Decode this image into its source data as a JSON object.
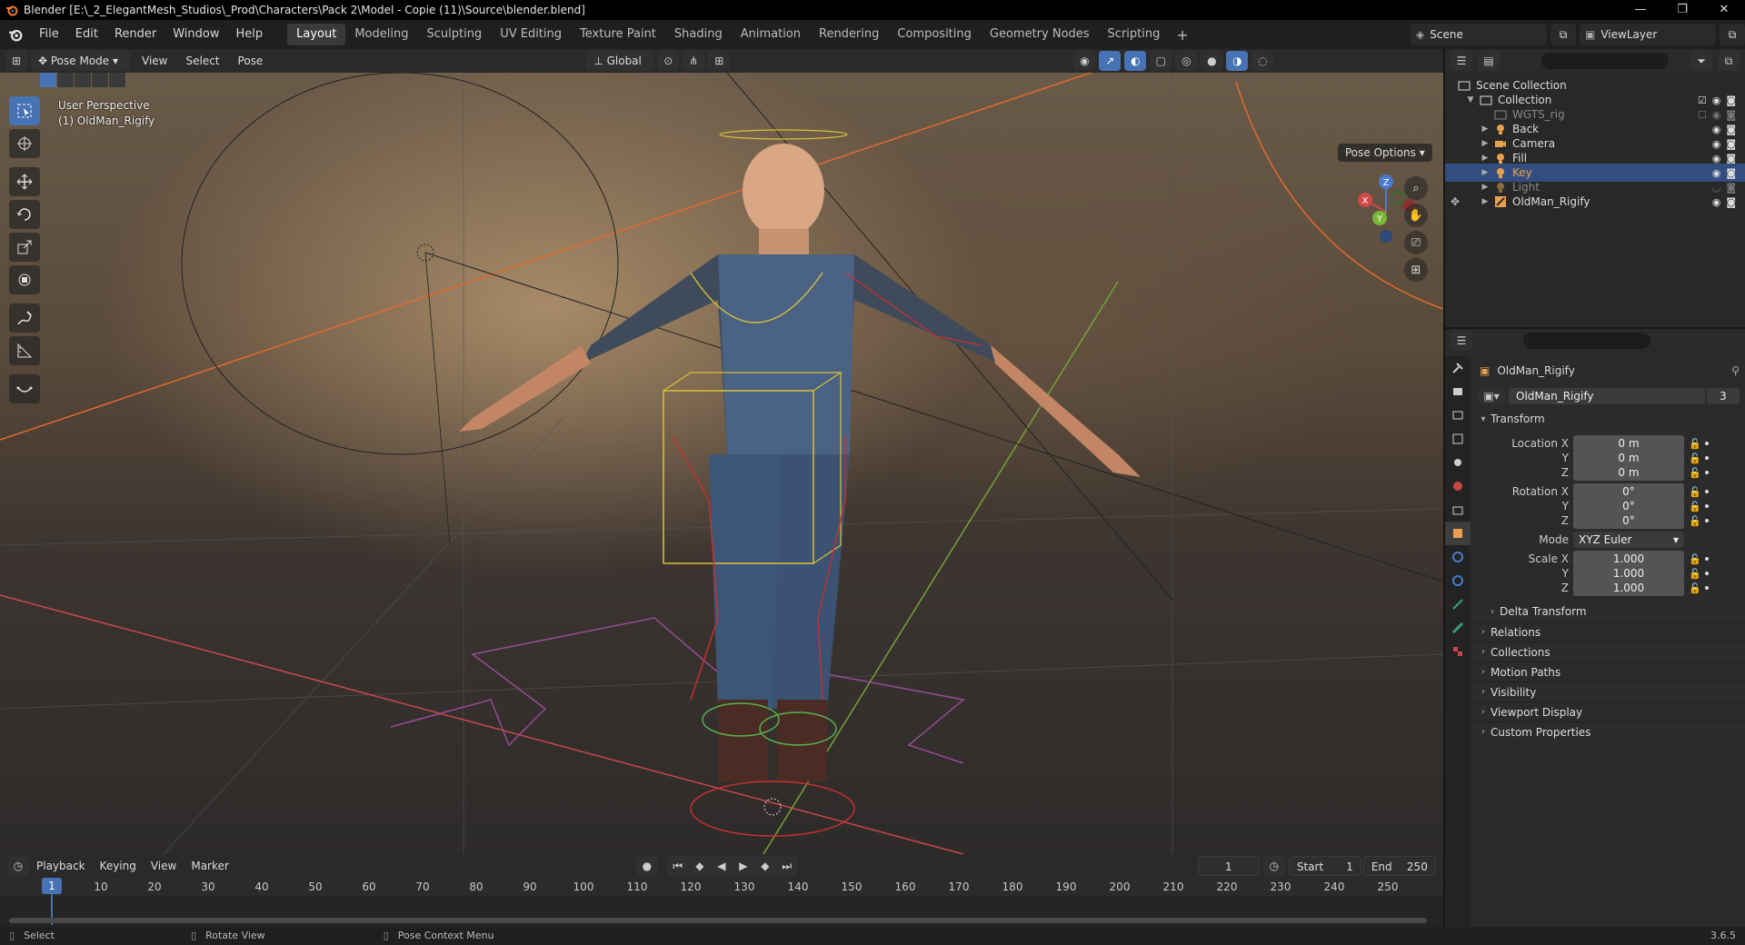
{
  "window": {
    "title": "Blender [E:\\_2_ElegantMesh_Studios\\_Prod\\Characters\\Pack 2\\Model - Copie (11)\\Source\\blender.blend]",
    "controls": [
      "—",
      "❐",
      "✕"
    ]
  },
  "menu": [
    "File",
    "Edit",
    "Render",
    "Window",
    "Help"
  ],
  "workspaces": [
    "Layout",
    "Modeling",
    "Sculpting",
    "UV Editing",
    "Texture Paint",
    "Shading",
    "Animation",
    "Rendering",
    "Compositing",
    "Geometry Nodes",
    "Scripting"
  ],
  "active_workspace": "Layout",
  "scene": {
    "name": "Scene",
    "view_layer": "ViewLayer"
  },
  "viewport_header": {
    "mode": "Pose Mode",
    "menus": [
      "View",
      "Select",
      "Pose"
    ],
    "orientation": "Global"
  },
  "viewport": {
    "perspective": "User Perspective",
    "object": "(1) OldMan_Rigify",
    "pose_options": "Pose Options",
    "gizmo_axes": [
      "X",
      "Y",
      "Z"
    ]
  },
  "timeline": {
    "menus": [
      "Playback",
      "Keying",
      "View",
      "Marker"
    ],
    "current_frame": "1",
    "start_label": "Start",
    "start": "1",
    "end_label": "End",
    "end": "250",
    "ticks": [
      "10",
      "20",
      "30",
      "40",
      "50",
      "60",
      "70",
      "80",
      "90",
      "100",
      "110",
      "120",
      "130",
      "140",
      "150",
      "160",
      "170",
      "180",
      "190",
      "200",
      "210",
      "220",
      "230",
      "240",
      "250"
    ],
    "playhead": "1"
  },
  "statusbar": {
    "select": "Select",
    "rotate": "Rotate View",
    "context": "Pose Context Menu",
    "version": "3.6.5"
  },
  "outliner": {
    "root": "Scene Collection",
    "collection": "Collection",
    "items": [
      {
        "name": "WGTS_rig",
        "style": "dim"
      },
      {
        "name": "Back",
        "style": "normal"
      },
      {
        "name": "Camera",
        "style": "normal"
      },
      {
        "name": "Fill",
        "style": "normal"
      },
      {
        "name": "Key",
        "style": "selected"
      },
      {
        "name": "Light",
        "style": "dim"
      },
      {
        "name": "OldMan_Rigify",
        "style": "normal"
      }
    ]
  },
  "properties": {
    "object_name": "OldMan_Rigify",
    "data_name": "OldMan_Rigify",
    "users": "3",
    "transform_title": "Transform",
    "location": {
      "label_x": "Location X",
      "x": "0 m",
      "y": "0 m",
      "z": "0 m"
    },
    "rotation": {
      "label_x": "Rotation X",
      "x": "0°",
      "y": "0°",
      "z": "0°"
    },
    "mode_label": "Mode",
    "mode": "XYZ Euler",
    "scale": {
      "label_x": "Scale X",
      "x": "1.000",
      "y": "1.000",
      "z": "1.000"
    },
    "axis_y": "Y",
    "axis_z": "Z",
    "delta": "Delta Transform",
    "panels": [
      "Relations",
      "Collections",
      "Motion Paths",
      "Visibility",
      "Viewport Display",
      "Custom Properties"
    ]
  }
}
